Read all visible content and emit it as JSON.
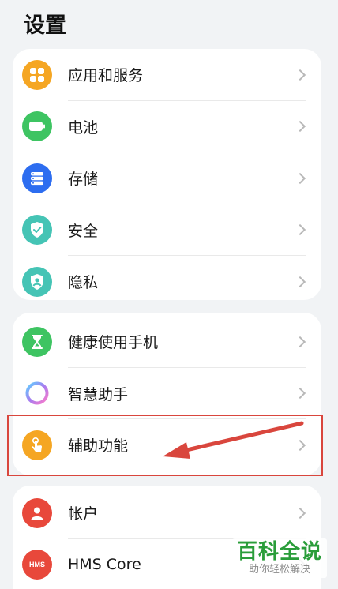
{
  "header": {
    "title": "设置"
  },
  "groups": [
    {
      "items": [
        {
          "label": "应用和服务",
          "icon": "apps-grid-icon",
          "color": "#f5a623"
        },
        {
          "label": "电池",
          "icon": "battery-icon",
          "color": "#3ec462"
        },
        {
          "label": "存储",
          "icon": "storage-icon",
          "color": "#2d6df0"
        },
        {
          "label": "安全",
          "icon": "shield-check-icon",
          "color": "#45c4b5"
        },
        {
          "label": "隐私",
          "icon": "privacy-shield-icon",
          "color": "#45c4b5"
        }
      ]
    },
    {
      "items": [
        {
          "label": "健康使用手机",
          "icon": "hourglass-icon",
          "color": "#3ec462"
        },
        {
          "label": "智慧助手",
          "icon": "smart-assistant-ring-icon",
          "color": "#a77cf0"
        },
        {
          "label": "辅助功能",
          "icon": "accessibility-hand-icon",
          "color": "#f5a623"
        }
      ]
    },
    {
      "items": [
        {
          "label": "帐户",
          "icon": "user-icon",
          "color": "#e8483b"
        },
        {
          "label": "HMS Core",
          "icon": "hms-icon",
          "icon_text": "HMS",
          "color": "#e8483b"
        }
      ]
    }
  ],
  "annotation": {
    "color": "#d9463d"
  },
  "watermark": {
    "title": "百科全说",
    "subtitle": "助你轻松解决"
  }
}
